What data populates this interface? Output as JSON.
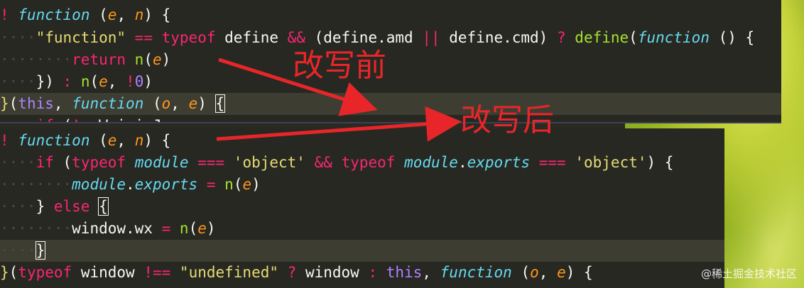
{
  "labels": {
    "before": "改写前",
    "after": "改写后"
  },
  "watermark": "@稀土掘金技术社区",
  "code_before": [
    "! function (e, n) {",
    "    \"function\" == typeof define && (define.amd || define.cmd) ? define(function () {",
    "        return n(e)",
    "    }) : n(e, !0)",
    "}(this, function (o, e) {",
    "    if (!e.WeixinJ"
  ],
  "code_after": [
    "! function (e, n) {",
    "    if (typeof module === 'object' && typeof module.exports === 'object') {",
    "        module.exports = n(e)",
    "    } else {",
    "        window.wx = n(e)",
    "    }",
    "}(typeof window !== \"undefined\" ? window : this, function (o, e) {"
  ],
  "colors": {
    "editor_bg": "#272822",
    "keyword": "#f92672",
    "function": "#66d9ef",
    "string": "#e6db74",
    "param": "#fd971f",
    "call": "#a6e22e",
    "number": "#ae81ff",
    "annotation": "#e8262a"
  }
}
